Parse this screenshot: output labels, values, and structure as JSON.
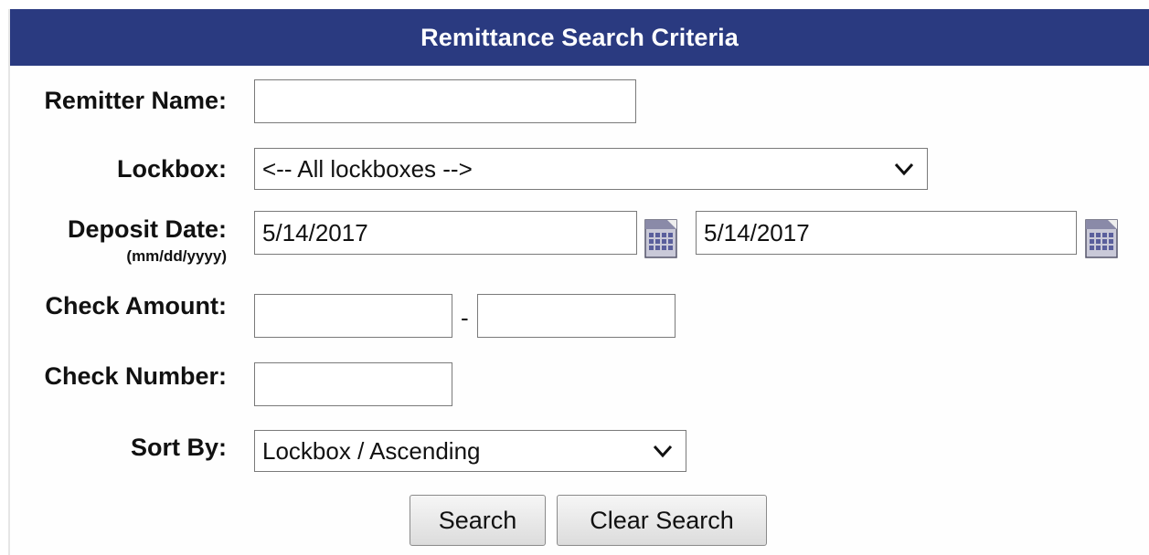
{
  "header": {
    "title": "Remittance Search Criteria"
  },
  "form": {
    "remitter_name": {
      "label": "Remitter Name:",
      "value": ""
    },
    "lockbox": {
      "label": "Lockbox:",
      "selected": "<-- All lockboxes -->"
    },
    "deposit_date": {
      "label": "Deposit Date:",
      "format_hint": "(mm/dd/yyyy)",
      "from_value": "5/14/2017",
      "to_value": "5/14/2017"
    },
    "check_amount": {
      "label": "Check Amount:",
      "from_value": "",
      "separator": "-",
      "to_value": ""
    },
    "check_number": {
      "label": "Check Number:",
      "value": ""
    },
    "sort_by": {
      "label": "Sort By:",
      "selected": "Lockbox / Ascending"
    }
  },
  "buttons": {
    "search": "Search",
    "clear_search": "Clear Search"
  },
  "colors": {
    "header_bg": "#2a3a80",
    "header_text": "#ffffff"
  },
  "icons": {
    "date_picker": "calendar-icon",
    "dropdown": "chevron-down-icon"
  }
}
